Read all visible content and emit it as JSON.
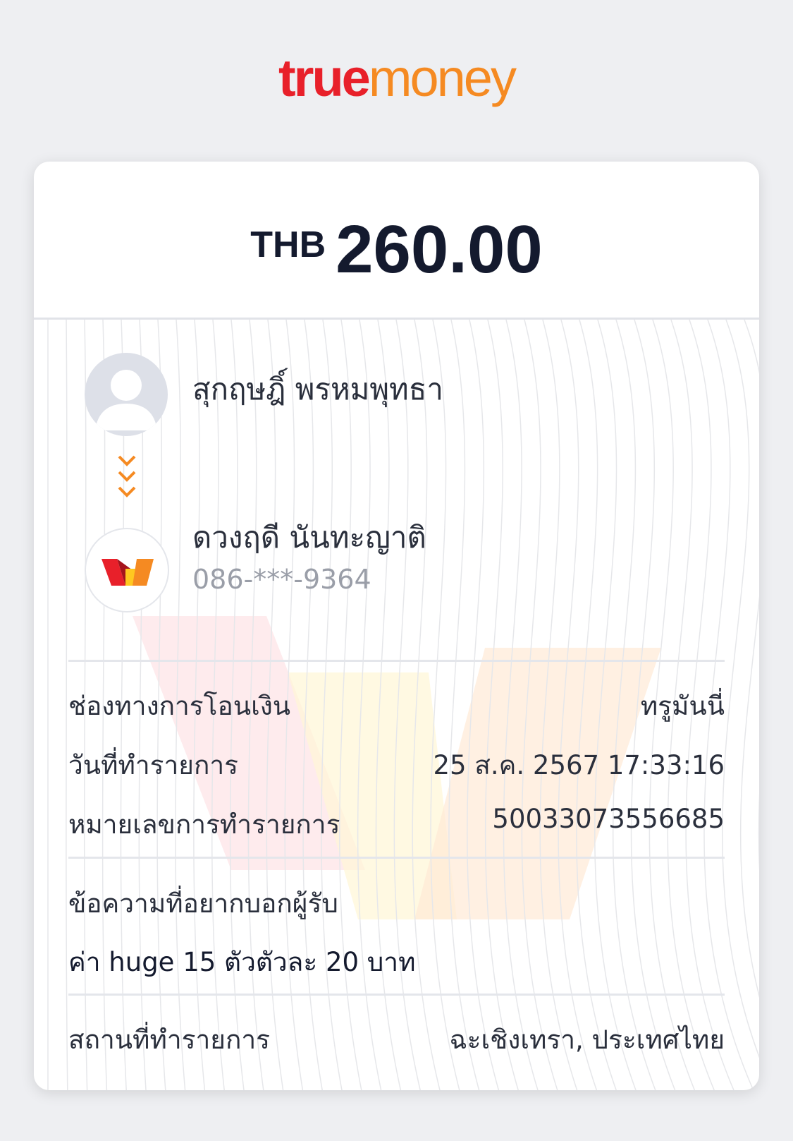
{
  "brand": {
    "part1": "true",
    "part2": "money",
    "colors": {
      "red": "#e8202a",
      "orange": "#f58a22"
    }
  },
  "amount": {
    "currency": "THB",
    "value": "260.00"
  },
  "sender": {
    "name": "สุกฤษฎิ์ พรหมพุทธา",
    "icon": "user-avatar-icon"
  },
  "recipient": {
    "name": "ดวงฤดี นันทะญาติ",
    "phone": "086-***-9364",
    "icon": "truemoney-wallet-icon"
  },
  "details": [
    {
      "label": "ช่องทางการโอนเงิน",
      "value": "ทรูมันนี่"
    },
    {
      "label": "วันที่ทำรายการ",
      "value": "25 ส.ค. 2567 17:33:16"
    },
    {
      "label": "หมายเลขการทำรายการ",
      "value": "50033073556685"
    }
  ],
  "message": {
    "label": "ข้อความที่อยากบอกผู้รับ",
    "text": "ค่า huge 15 ตัวตัวละ 20 บาท"
  },
  "location": {
    "label": "สถานที่ทำรายการ",
    "value": "ฉะเชิงเทรา, ประเทศไทย"
  }
}
